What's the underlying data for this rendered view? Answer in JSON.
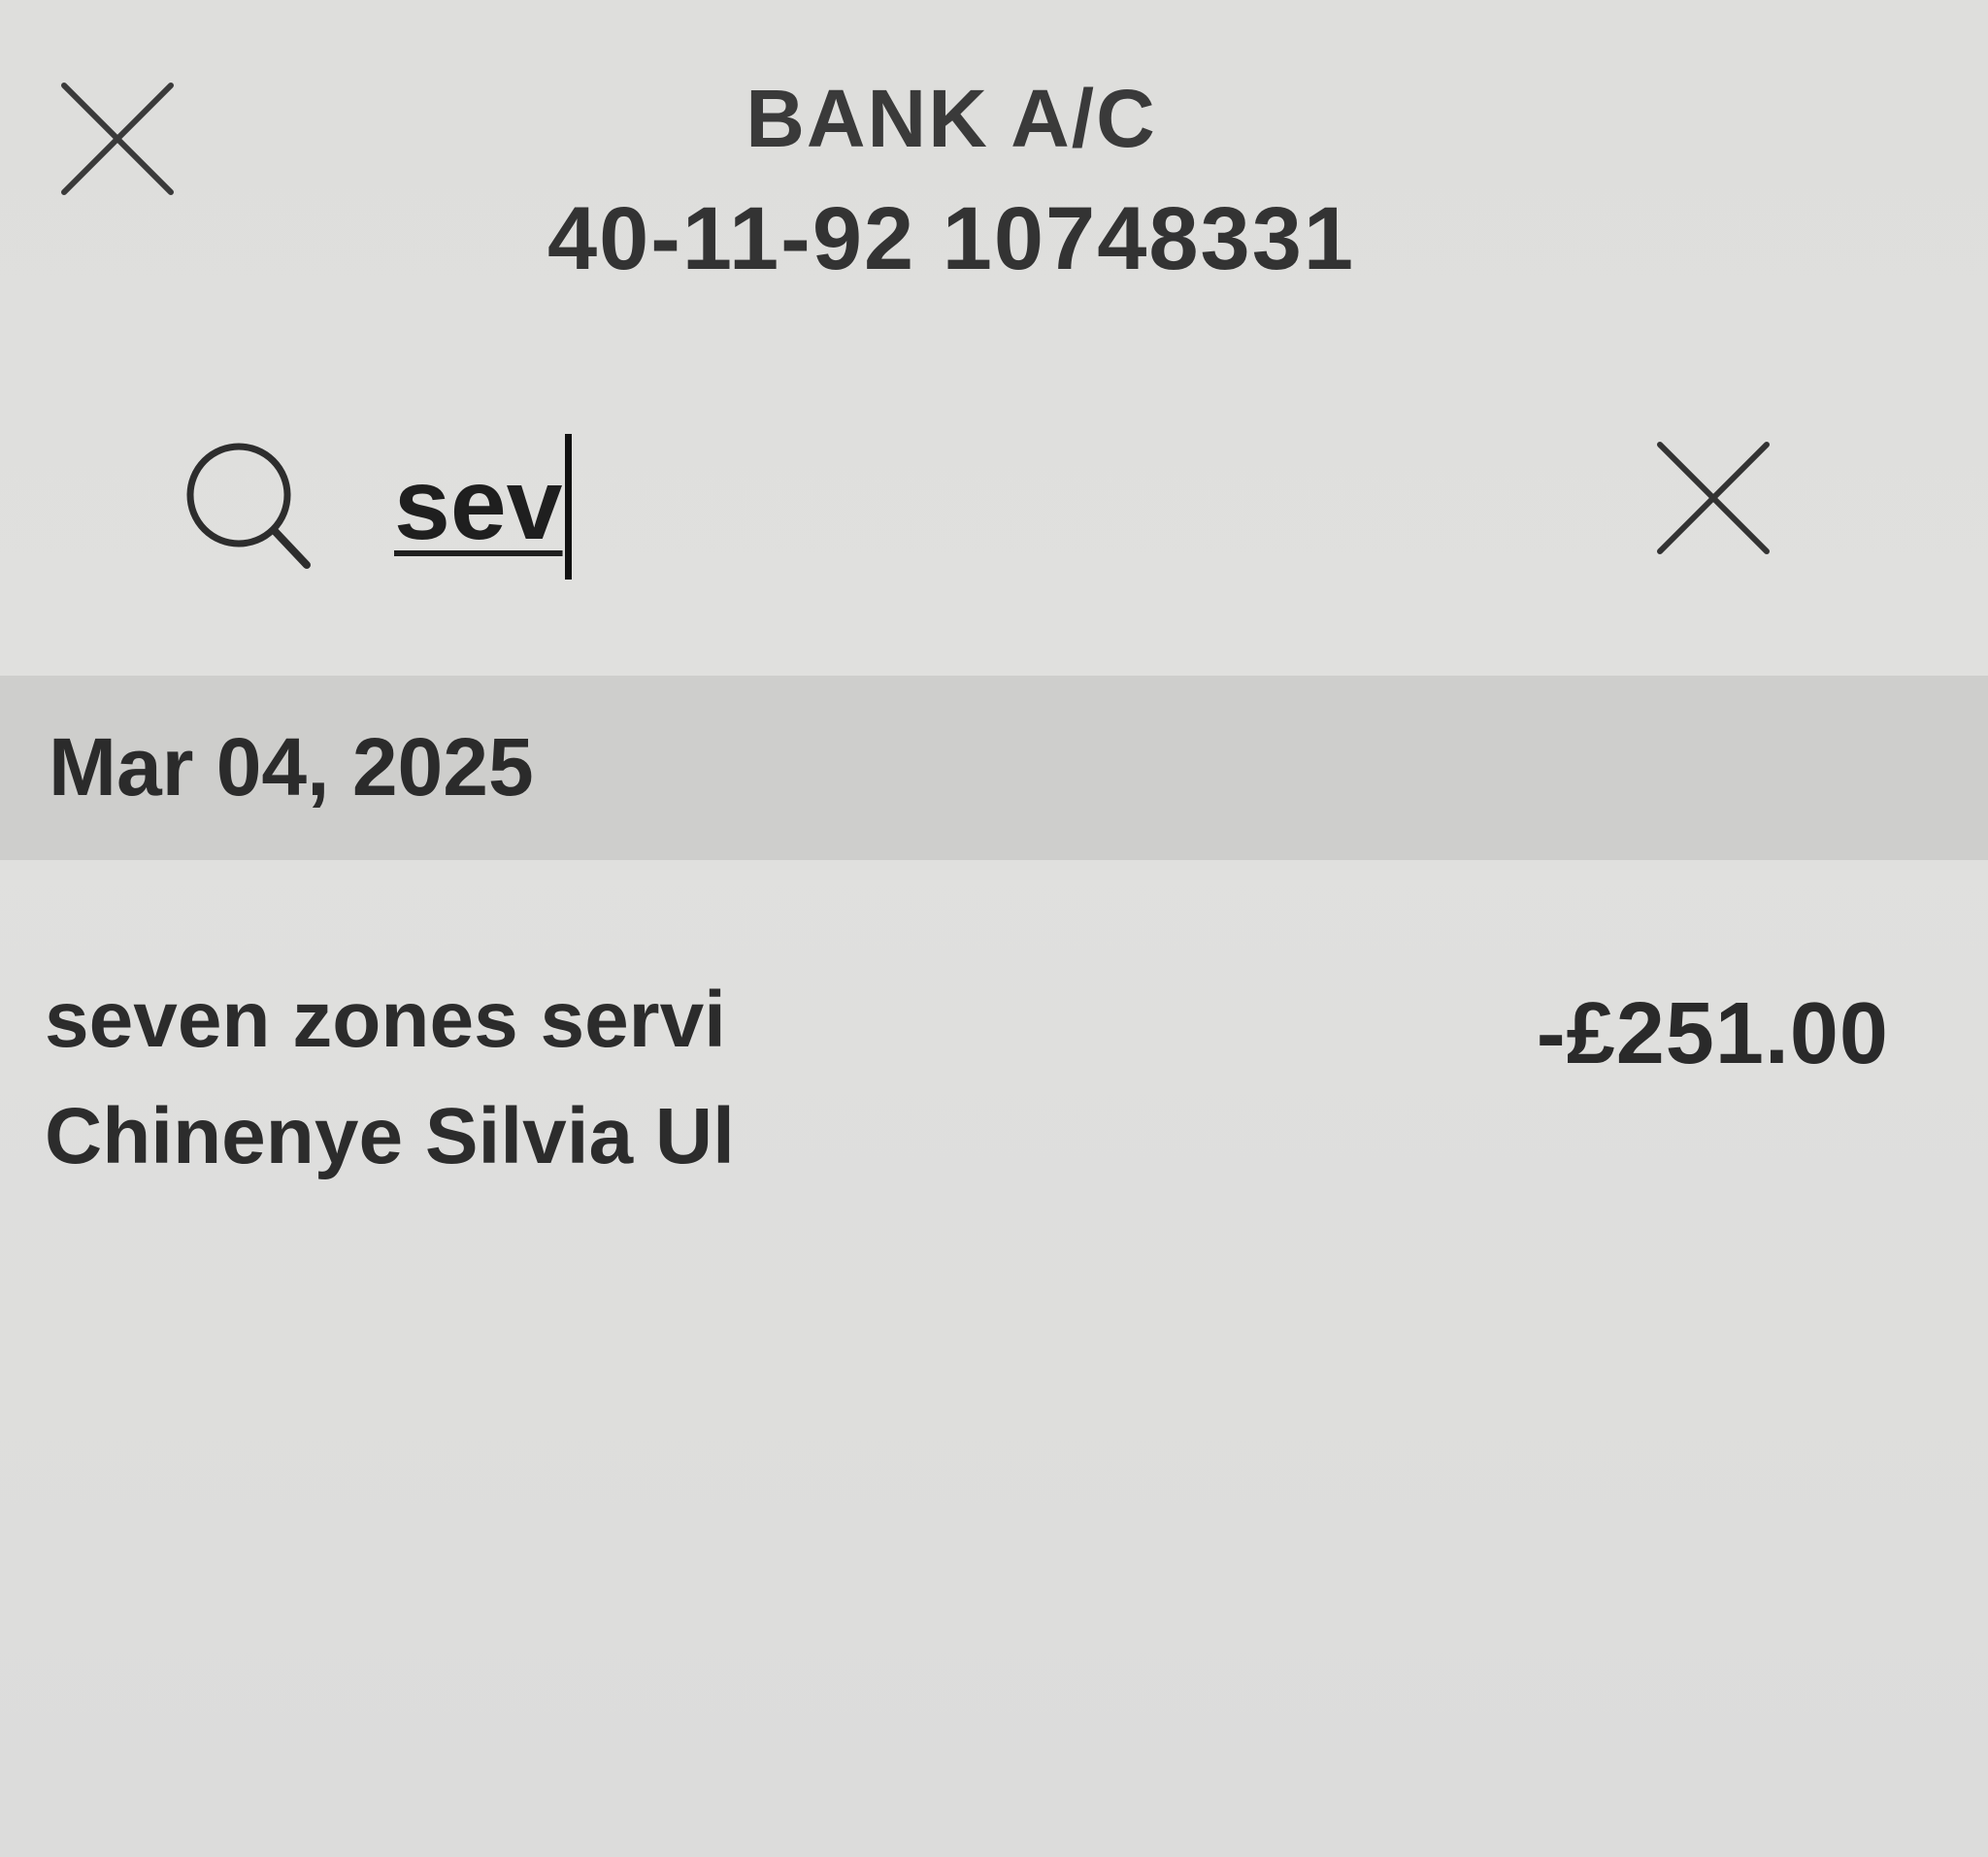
{
  "header": {
    "close_icon": "close-icon",
    "title": "BANK A/C",
    "account_number": "40-11-92 10748331"
  },
  "search": {
    "icon": "search-icon",
    "value": "sev",
    "clear_icon": "close-icon"
  },
  "results": [
    {
      "date": "Mar 04, 2025",
      "transactions": [
        {
          "description": "seven zones servi",
          "payee": "Chinenye Silvia Ul",
          "amount": "-£251.00"
        }
      ]
    }
  ]
}
